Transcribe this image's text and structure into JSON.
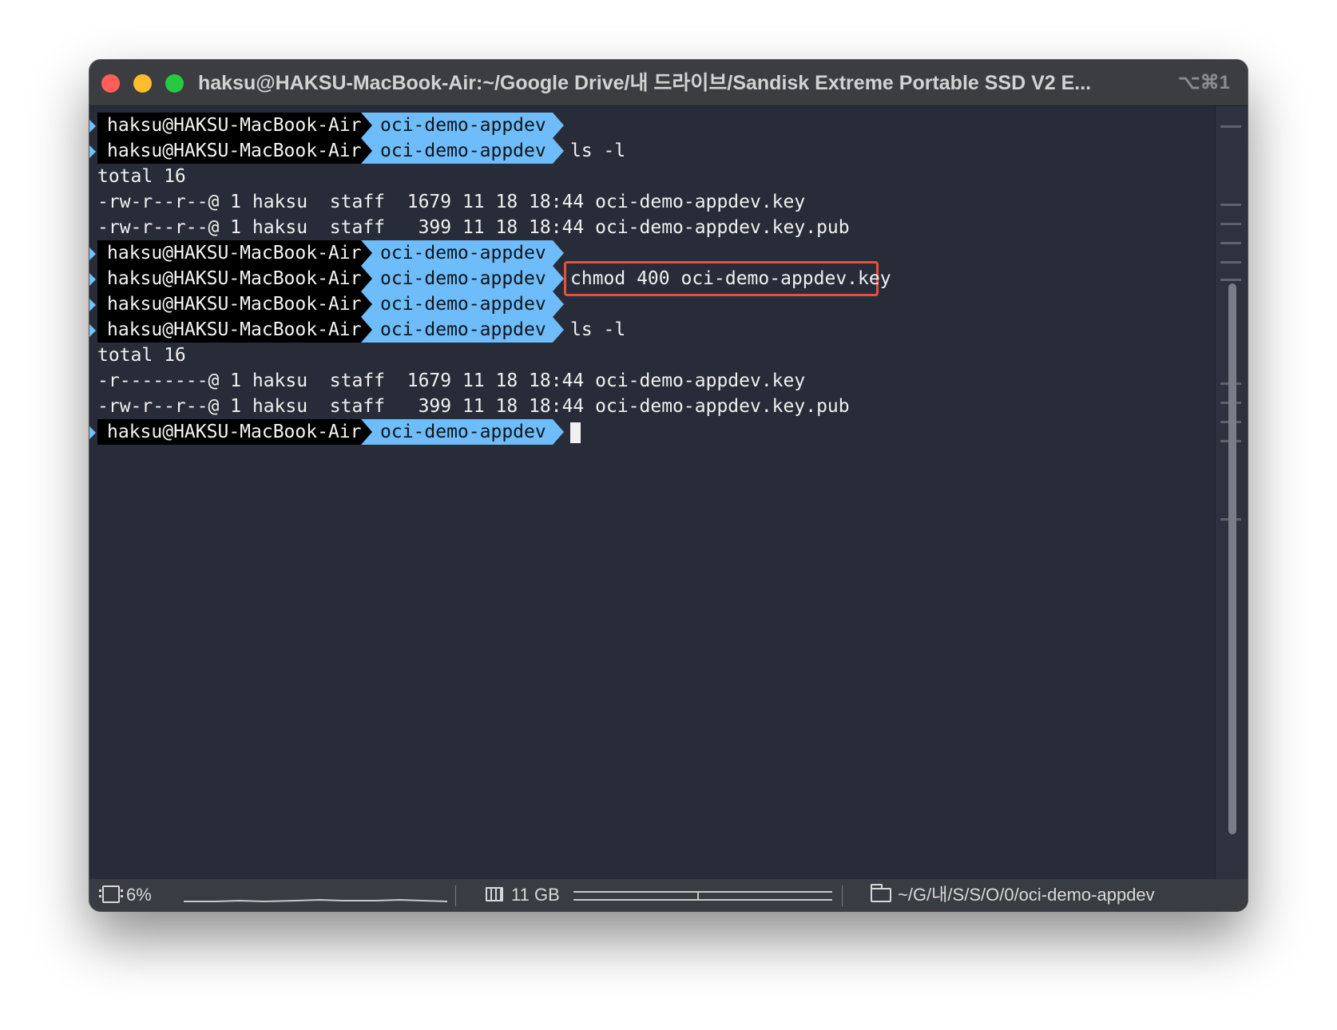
{
  "titlebar": {
    "title": "haksu@HAKSU-MacBook-Air:~/Google Drive/내 드라이브/Sandisk Extreme Portable SSD V2 E...",
    "shortcut": "⌥⌘1"
  },
  "prompt": {
    "host": "haksu@HAKSU-MacBook-Air",
    "dir": "oci-demo-appdev"
  },
  "terminal": {
    "cmd_ls": "ls -l",
    "cmd_chmod": "chmod 400 oci-demo-appdev.key",
    "total": "total 16",
    "listing_before": [
      "-rw-r--r--@ 1 haksu  staff  1679 11 18 18:44 oci-demo-appdev.key",
      "-rw-r--r--@ 1 haksu  staff   399 11 18 18:44 oci-demo-appdev.key.pub"
    ],
    "listing_after": [
      "-r--------@ 1 haksu  staff  1679 11 18 18:44 oci-demo-appdev.key",
      "-rw-r--r--@ 1 haksu  staff   399 11 18 18:44 oci-demo-appdev.key.pub"
    ]
  },
  "statusbar": {
    "cpu": "6%",
    "memory": "11 GB",
    "path": "~/G/내/S/S/O/0/oci-demo-appdev"
  },
  "colors": {
    "background": "#282c38",
    "prompt_host_bg": "#000000",
    "prompt_dir_bg": "#6ebdfa",
    "highlight_border": "#e2533a"
  },
  "icons": [
    "cpu-icon",
    "memory-icon",
    "folder-icon"
  ]
}
